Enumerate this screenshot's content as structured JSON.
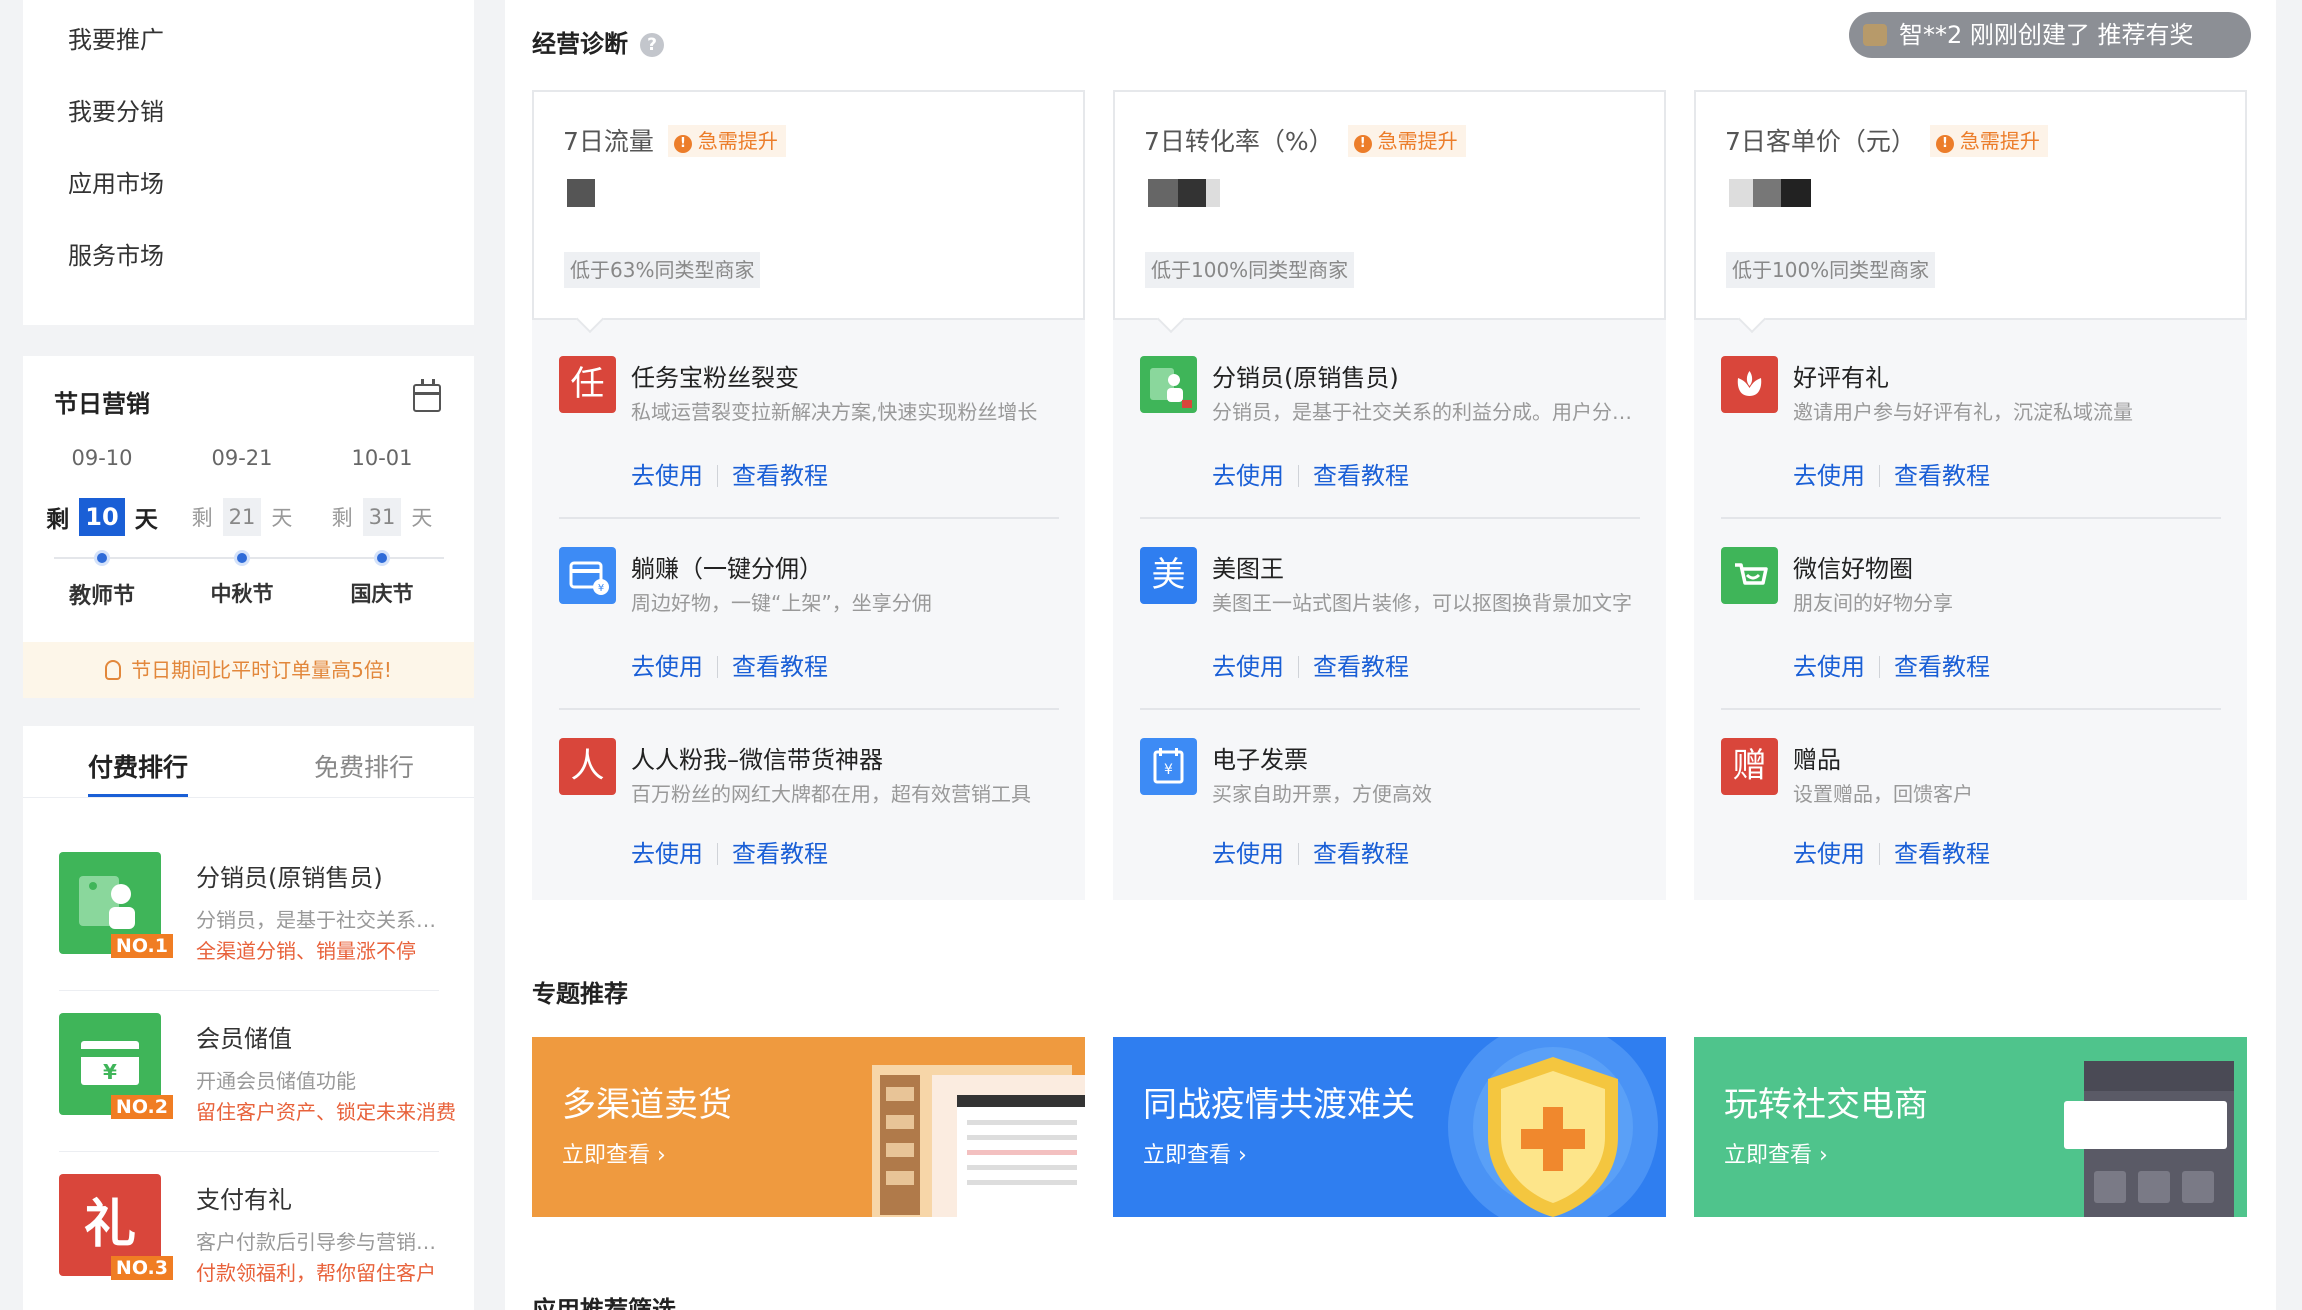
{
  "sidebar_menu": [
    "我要推广",
    "我要分销",
    "应用市场",
    "服务市场"
  ],
  "festival": {
    "title": "节日营销",
    "remain_prefix": "剩",
    "remain_suffix": "天",
    "items": [
      {
        "date": "09-10",
        "days": "10",
        "name": "教师节"
      },
      {
        "date": "09-21",
        "days": "21",
        "name": "中秋节"
      },
      {
        "date": "10-01",
        "days": "31",
        "name": "国庆节"
      }
    ],
    "tip": "节日期间比平时订单量高5倍!"
  },
  "ranking": {
    "tabs": [
      "付费排行",
      "免费排行"
    ],
    "items": [
      {
        "name": "分销员(原销售员)",
        "desc": "分销员，是基于社交关系的利益分成，用户分享商品成交后获得佣金",
        "slogan": "全渠道分销、销量涨不停",
        "badge": "NO.1",
        "color": "#3fb559"
      },
      {
        "name": "会员储值",
        "desc": "开通会员储值功能",
        "slogan": "留住客户资产、锁定未来消费",
        "badge": "NO.2",
        "color": "#3fb559"
      },
      {
        "name": "支付有礼",
        "desc": "客户付款后引导参与营销活动",
        "slogan": "付款领福利，帮你留住客户",
        "badge": "NO.3",
        "color": "#d9463b",
        "glyph": "礼"
      }
    ]
  },
  "diagnosis": {
    "title": "经营诊断",
    "help": "?",
    "notice": "智**2 刚刚创建了 推荐有奖",
    "urgent_label": "急需提升",
    "columns": [
      {
        "metric": "7日流量",
        "compare": "低于63%同类型商家",
        "apps": [
          {
            "glyph": "任",
            "color": "#d9463b",
            "name": "任务宝粉丝裂变",
            "desc": "私域运营裂变拉新解决方案,快速实现粉丝增长"
          },
          {
            "glyph": "",
            "color": "#3d8bf5",
            "name": "躺赚（一键分佣）",
            "desc": "周边好物，一键“上架”，坐享分佣"
          },
          {
            "glyph": "人",
            "color": "#d9463b",
            "name": "人人粉我–微信带货神器",
            "desc": "百万粉丝的网红大牌都在用，超有效营销工具"
          }
        ]
      },
      {
        "metric": "7日转化率（%）",
        "compare": "低于100%同类型商家",
        "apps": [
          {
            "glyph": "",
            "color": "#3fb559",
            "name": "分销员(原销售员)",
            "desc": "分销员，是基于社交关系的利益分成。用户分享赚佣金"
          },
          {
            "glyph": "美",
            "color": "#2f7ef0",
            "name": "美图王",
            "desc": "美图王一站式图片装修，可以抠图换背景加文字"
          },
          {
            "glyph": "",
            "color": "#3d8bf5",
            "name": "电子发票",
            "desc": "买家自助开票，方便高效"
          }
        ]
      },
      {
        "metric": "7日客单价（元）",
        "compare": "低于100%同类型商家",
        "apps": [
          {
            "glyph": "",
            "color": "#d9463b",
            "name": "好评有礼",
            "desc": "邀请用户参与好评有礼，沉淀私域流量"
          },
          {
            "glyph": "",
            "color": "#3fb559",
            "name": "微信好物圈",
            "desc": "朋友间的好物分享"
          },
          {
            "glyph": "赠",
            "color": "#d9463b",
            "name": "赠品",
            "desc": "设置赠品，回馈客户"
          }
        ]
      }
    ],
    "actions": {
      "use": "去使用",
      "tutorial": "查看教程"
    }
  },
  "topics": {
    "title": "专题推荐",
    "link": "立即查看 ›",
    "banners": [
      {
        "title": "多渠道卖货",
        "color": "#ef9a3f"
      },
      {
        "title": "同战疫情共渡难关",
        "color": "#2f7ef0"
      },
      {
        "title": "玩转社交电商",
        "color": "#4fc48c"
      }
    ]
  },
  "next_section_title": "应用推荐筛选"
}
